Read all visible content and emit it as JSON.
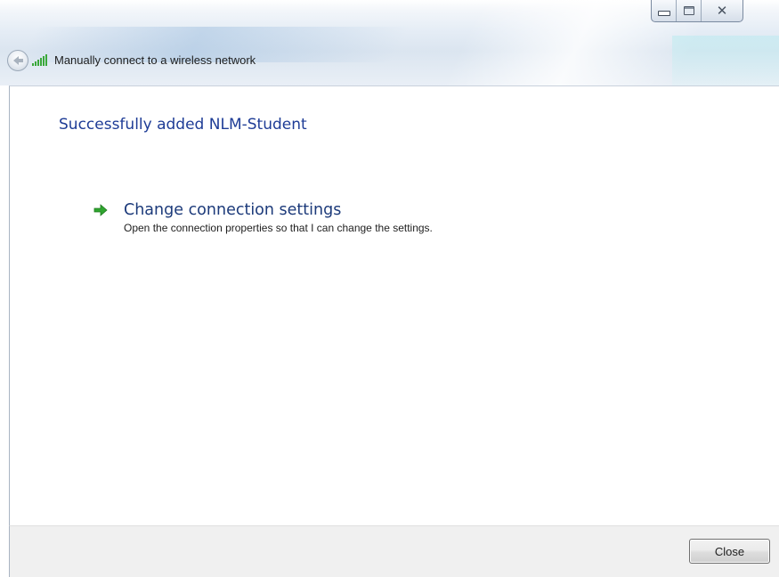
{
  "window": {
    "title": "Manually connect to a wireless network",
    "controls": {
      "minimize_icon": "minimize-icon",
      "maximize_icon": "maximize-icon",
      "close_icon": "close-icon"
    }
  },
  "content": {
    "heading": "Successfully added NLM-Student",
    "task_link": {
      "title": "Change connection settings",
      "description": "Open the connection properties so that I can change the settings.",
      "icon": "green-arrow-icon"
    }
  },
  "footer": {
    "close_label": "Close"
  },
  "colors": {
    "heading": "#1e3c96",
    "link": "#1c3a7a",
    "arrow": "#2fa52f",
    "signal": "#3aa83a"
  }
}
